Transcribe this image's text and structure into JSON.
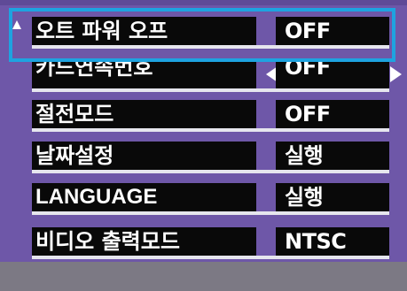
{
  "menu": {
    "items": [
      {
        "label": "오트 파워 오프",
        "value": "OFF"
      },
      {
        "label": "카드연속번호",
        "value": "OFF"
      },
      {
        "label": "절전모드",
        "value": "OFF"
      },
      {
        "label": "날짜설정",
        "value": "실행"
      },
      {
        "label": "LANGUAGE",
        "value": "실행"
      },
      {
        "label": "비디오 출력모드",
        "value": "NTSC"
      }
    ]
  },
  "colors": {
    "background": "#6e57a8",
    "box": "#090909",
    "text": "#ffffff",
    "highlight": "#1ea3e0"
  }
}
